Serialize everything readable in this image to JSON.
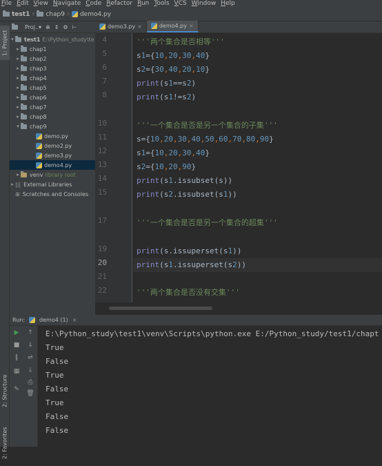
{
  "menu": [
    "File",
    "Edit",
    "View",
    "Navigate",
    "Code",
    "Refactor",
    "Run",
    "Tools",
    "VCS",
    "Window",
    "Help"
  ],
  "breadcrumb": [
    "test1",
    "chap9",
    "demo4.py"
  ],
  "left_tabs": [
    "1: Project",
    "2: Structure",
    "2: Favorites"
  ],
  "project": {
    "header": "Proj..▾",
    "root_name": "test1",
    "root_path": "E:\\Python_study\\te",
    "folders": [
      "chap1",
      "chap2",
      "chap3",
      "chap4",
      "chap5",
      "chap6",
      "chap7",
      "chap8",
      "chap9"
    ],
    "files": [
      "demo.py",
      "demo2.py",
      "demo3.py",
      "demo4.py"
    ],
    "venv": "venv",
    "venv_note": "library root",
    "external": "External Libraries",
    "scratches": "Scratches and Consoles"
  },
  "tabs": [
    "demo3.py",
    "demo4.py"
  ],
  "line_numbers": [
    "4",
    "5",
    "6",
    "7",
    "8",
    "10",
    "11",
    "12",
    "13",
    "14",
    "15",
    "17",
    "19",
    "20",
    "21",
    "22"
  ],
  "code": [
    "'''两个集合是否相等'''",
    "s1={10,20,30,40}",
    "s2={30,40,20,10}",
    "print(s1==s2)",
    "print(s1!=s2)",
    "'''一个集合是否是另一个集合的子集'''",
    "s={10,20,30,40,50,60,70,80,90}",
    "s1={10,20,30,40}",
    "s2={10,20,90}",
    "print(s1.issubset(s))",
    "print(s2.issubset(s1))",
    "'''一个集合是否是另一个集合的超集'''",
    "print(s.issuperset(s1))",
    "print(s1.issuperset(s2))",
    "'''两个集合是否没有交集'''"
  ],
  "run": {
    "label": "Run:",
    "tab": "demo4 (1)",
    "command": "E:\\Python_study\\test1\\venv\\Scripts\\python.exe E:/Python_study/test1/chapt",
    "output": [
      "True",
      "False",
      "True",
      "False",
      "True",
      "False",
      "False"
    ]
  },
  "colors": {
    "keyword": "#8888c6",
    "string": "#6a8759",
    "number": "#6897bb",
    "operator": "#cc7832",
    "selection": "#0d293e"
  }
}
